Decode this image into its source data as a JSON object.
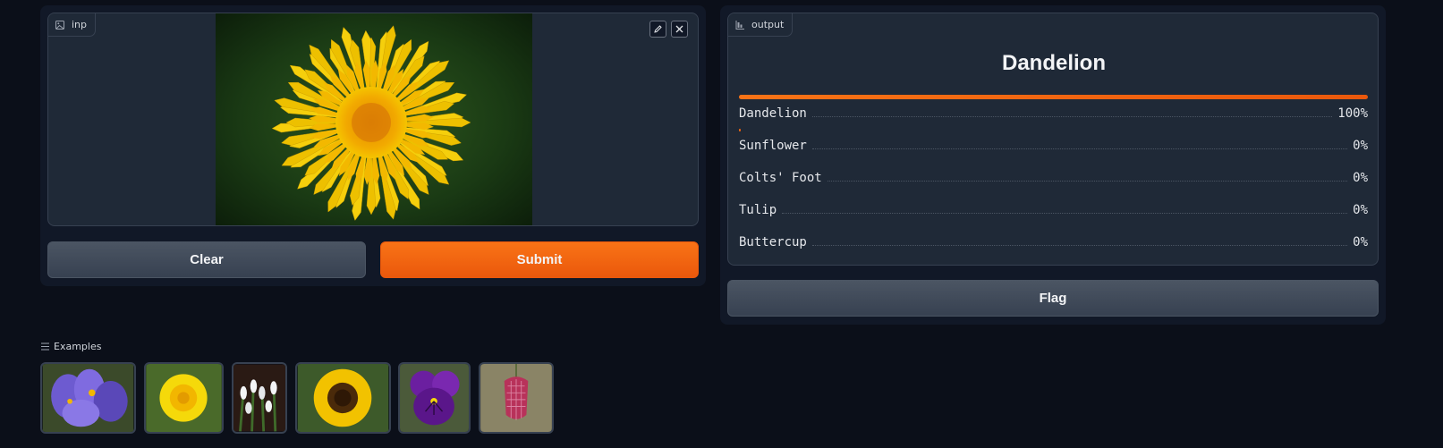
{
  "input": {
    "label": "inp",
    "image_subject": "dandelion"
  },
  "buttons": {
    "clear": "Clear",
    "submit": "Submit",
    "flag": "Flag"
  },
  "output": {
    "label": "output",
    "prediction": "Dandelion",
    "confidences": [
      {
        "label": "Dandelion",
        "value": "100%",
        "fraction": 1.0
      },
      {
        "label": "Sunflower",
        "value": "0%",
        "fraction": 0.0
      },
      {
        "label": "Colts' Foot",
        "value": "0%",
        "fraction": 0.0
      },
      {
        "label": "Tulip",
        "value": "0%",
        "fraction": 0.0
      },
      {
        "label": "Buttercup",
        "value": "0%",
        "fraction": 0.0
      }
    ]
  },
  "examples": {
    "title": "Examples",
    "items": [
      "crocus",
      "dandelion",
      "snowdrops",
      "sunflower",
      "pansy",
      "snakes-head-fritillary"
    ]
  },
  "colors": {
    "accent": "#f97316",
    "background": "#0b0f19",
    "panel": "#111827",
    "box": "#1f2937"
  }
}
